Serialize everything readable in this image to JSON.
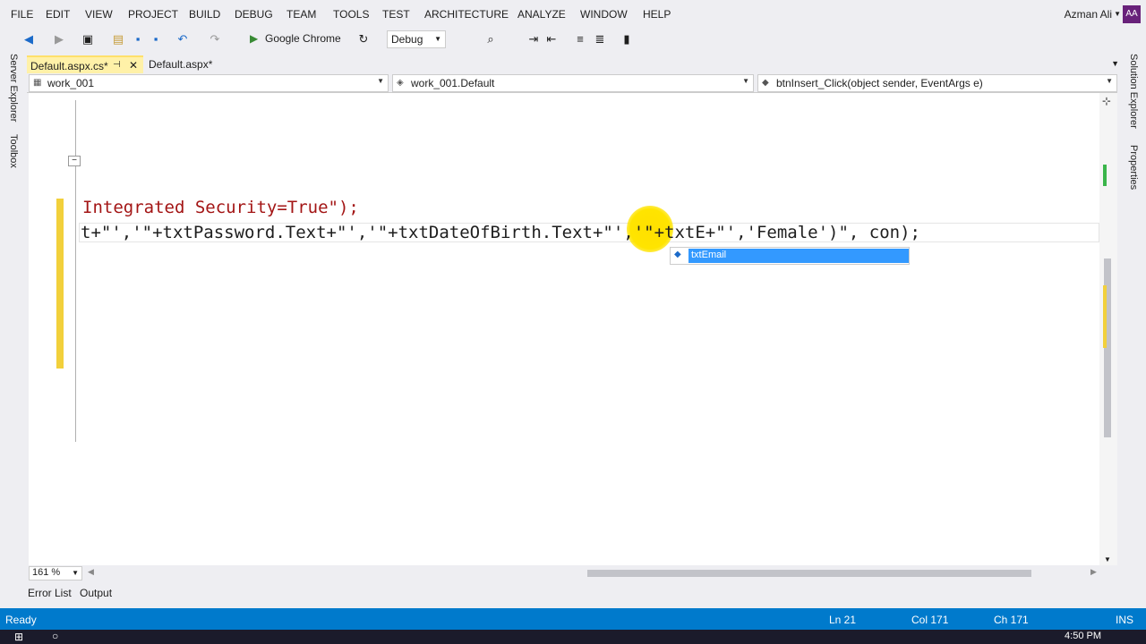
{
  "menu": {
    "items": [
      "FILE",
      "EDIT",
      "VIEW",
      "PROJECT",
      "BUILD",
      "DEBUG",
      "TEAM",
      "TOOLS",
      "TEST",
      "ARCHITECTURE",
      "ANALYZE",
      "WINDOW",
      "HELP"
    ],
    "user": "Azman Ali",
    "avatar": "AA"
  },
  "toolbar": {
    "run_label": "Google Chrome",
    "config": "Debug"
  },
  "side_tabs": {
    "left": [
      "Server Explorer",
      "Toolbox"
    ],
    "right": [
      "Solution Explorer",
      "Properties"
    ]
  },
  "doc_tabs": {
    "active": "Default.aspx.cs*",
    "other": "Default.aspx*"
  },
  "navbar": {
    "project": "work_001",
    "class": "work_001.Default",
    "member": "btnInsert_Click(object sender, EventArgs e)"
  },
  "code": {
    "line1": "Integrated Security=True\");",
    "line2": "t+\"','\"+txtPassword.Text+\"','\"+txtDateOfBirth.Text+\"','\"+txtE+\"','Female')\", con);"
  },
  "completion": {
    "item": "txtEmail",
    "icon": "field-icon"
  },
  "footer": {
    "zoom": "161 %"
  },
  "bottom_tabs": [
    "Error List",
    "Output"
  ],
  "status": {
    "left": "Ready",
    "ln": "Ln 21",
    "col": "Col 171",
    "ch": "Ch 171",
    "mode": "INS"
  },
  "taskbar": {
    "clock": "4:50 PM"
  },
  "colors": {
    "status_bar": "#007acc",
    "active_tab": "#fff1a8",
    "string": "#a31515",
    "completion_selection": "#3399ff"
  }
}
